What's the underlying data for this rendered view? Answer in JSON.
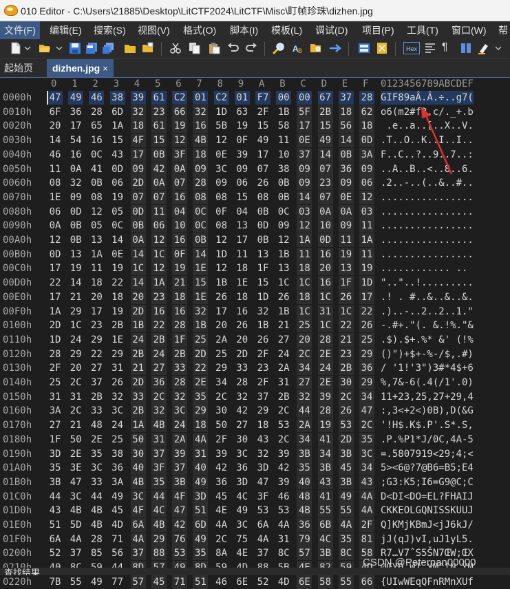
{
  "title": "010 Editor - C:\\Users\\21885\\Desktop\\LitCTF2024\\LitCTF\\Misc\\盯帧珍珠\\dizhen.jpg",
  "menu": [
    "文件(F)",
    "编辑(E)",
    "搜索(S)",
    "视图(V)",
    "格式(O)",
    "脚本(I)",
    "模板(L)",
    "调试(D)",
    "项目(P)",
    "工具(T)",
    "窗口(W)",
    "帮"
  ],
  "toolbar": {
    "icons": [
      "new-file-icon",
      "open-folder-icon",
      "save-icon",
      "save-as-icon",
      "save-all-icon",
      "folder-icon",
      "folder-open-icon",
      "cut-icon",
      "copy-icon",
      "paste-icon",
      "undo-icon",
      "redo-icon",
      "find-icon",
      "find-replace-icon",
      "find-in-files-icon",
      "goto-icon",
      "compare-icon",
      "calculator-icon",
      "hex-view-icon",
      "format-icon",
      "paragraph-icon",
      "columns-icon",
      "highlight-icon"
    ],
    "hex_label": "Hex",
    "colors": {
      "blue": "#3c78d8",
      "yellow": "#e8b830",
      "orange": "#e08a20"
    }
  },
  "tabs": {
    "home": "起始页",
    "file": "dizhen.jpg",
    "close": "×"
  },
  "hex_header": {
    "columns": [
      "0",
      "1",
      "2",
      "3",
      "4",
      "5",
      "6",
      "7",
      "8",
      "9",
      "A",
      "B",
      "C",
      "D",
      "E",
      "F"
    ],
    "ascii": "0123456789ABCDEF"
  },
  "rows": [
    {
      "addr": "0000h",
      "hex": [
        "47",
        "49",
        "46",
        "38",
        "39",
        "61",
        "C2",
        "01",
        "C2",
        "01",
        "F7",
        "00",
        "00",
        "67",
        "37",
        "28"
      ],
      "ascii": "GIF89aÂ.Â.÷..g7("
    },
    {
      "addr": "0010h",
      "hex": [
        "6F",
        "36",
        "28",
        "6D",
        "32",
        "23",
        "66",
        "32",
        "1D",
        "63",
        "2F",
        "1B",
        "5F",
        "2B",
        "18",
        "62"
      ],
      "ascii": "o6(m2#f2.c/._+.b"
    },
    {
      "addr": "0020h",
      "hex": [
        "20",
        "17",
        "65",
        "1A",
        "18",
        "61",
        "19",
        "16",
        "5B",
        "19",
        "15",
        "58",
        "17",
        "15",
        "56",
        "18"
      ],
      "ascii": " .e..a..[..X..V."
    },
    {
      "addr": "0030h",
      "hex": [
        "14",
        "54",
        "16",
        "15",
        "4F",
        "15",
        "12",
        "4B",
        "12",
        "0F",
        "49",
        "11",
        "0E",
        "49",
        "14",
        "0D"
      ],
      "ascii": ".T..O..K..I..I.."
    },
    {
      "addr": "0040h",
      "hex": [
        "46",
        "16",
        "0C",
        "43",
        "17",
        "0B",
        "3F",
        "18",
        "0E",
        "39",
        "17",
        "10",
        "37",
        "14",
        "0B",
        "3A"
      ],
      "ascii": "F..C..?..9..7..:"
    },
    {
      "addr": "0050h",
      "hex": [
        "11",
        "0A",
        "41",
        "0D",
        "09",
        "42",
        "0A",
        "09",
        "3C",
        "09",
        "07",
        "38",
        "09",
        "07",
        "36",
        "09"
      ],
      "ascii": "..A..B..<..8..6."
    },
    {
      "addr": "0060h",
      "hex": [
        "08",
        "32",
        "0B",
        "06",
        "2D",
        "0A",
        "07",
        "28",
        "09",
        "06",
        "26",
        "0B",
        "09",
        "23",
        "09",
        "06"
      ],
      "ascii": ".2..-..(..&..#.."
    },
    {
      "addr": "0070h",
      "hex": [
        "1E",
        "09",
        "08",
        "19",
        "07",
        "07",
        "16",
        "08",
        "08",
        "15",
        "08",
        "0B",
        "14",
        "07",
        "0E",
        "12"
      ],
      "ascii": "................"
    },
    {
      "addr": "0080h",
      "hex": [
        "06",
        "0D",
        "12",
        "05",
        "0D",
        "11",
        "04",
        "0C",
        "0F",
        "04",
        "0B",
        "0C",
        "03",
        "0A",
        "0A",
        "03"
      ],
      "ascii": "................"
    },
    {
      "addr": "0090h",
      "hex": [
        "0A",
        "0B",
        "05",
        "0C",
        "0B",
        "06",
        "10",
        "0C",
        "08",
        "13",
        "0D",
        "09",
        "12",
        "10",
        "09",
        "11"
      ],
      "ascii": "................"
    },
    {
      "addr": "00A0h",
      "hex": [
        "12",
        "0B",
        "13",
        "14",
        "0A",
        "12",
        "16",
        "0B",
        "12",
        "17",
        "0B",
        "12",
        "1A",
        "0D",
        "11",
        "1A"
      ],
      "ascii": "................"
    },
    {
      "addr": "00B0h",
      "hex": [
        "0D",
        "13",
        "1A",
        "0E",
        "14",
        "1C",
        "0F",
        "14",
        "1D",
        "11",
        "13",
        "1B",
        "11",
        "16",
        "19",
        "11"
      ],
      "ascii": "................"
    },
    {
      "addr": "00C0h",
      "hex": [
        "17",
        "19",
        "11",
        "19",
        "1C",
        "12",
        "19",
        "1E",
        "12",
        "18",
        "1F",
        "13",
        "18",
        "20",
        "13",
        "19"
      ],
      "ascii": "............ .. "
    },
    {
      "addr": "00D0h",
      "hex": [
        "22",
        "14",
        "18",
        "22",
        "14",
        "1A",
        "21",
        "15",
        "1B",
        "1E",
        "15",
        "1C",
        "1C",
        "16",
        "1F",
        "1D"
      ],
      "ascii": "\"..\"..!........."
    },
    {
      "addr": "00E0h",
      "hex": [
        "17",
        "21",
        "20",
        "18",
        "20",
        "23",
        "18",
        "1E",
        "26",
        "18",
        "1D",
        "26",
        "18",
        "1C",
        "26",
        "17"
      ],
      "ascii": ".! . #..&..&..&."
    },
    {
      "addr": "00F0h",
      "hex": [
        "1A",
        "29",
        "17",
        "19",
        "2D",
        "16",
        "16",
        "32",
        "17",
        "16",
        "32",
        "1B",
        "1C",
        "31",
        "1C",
        "22"
      ],
      "ascii": ".)..-..2..2..1.\""
    },
    {
      "addr": "0100h",
      "hex": [
        "2D",
        "1C",
        "23",
        "2B",
        "1B",
        "22",
        "28",
        "1B",
        "20",
        "26",
        "1B",
        "21",
        "25",
        "1C",
        "22",
        "26"
      ],
      "ascii": "-.#+.\"(. &.!%.\"&"
    },
    {
      "addr": "0110h",
      "hex": [
        "1D",
        "24",
        "29",
        "1E",
        "24",
        "2B",
        "1F",
        "25",
        "2A",
        "20",
        "26",
        "27",
        "20",
        "28",
        "21",
        "25"
      ],
      "ascii": ".$).$+.%* &' (!%"
    },
    {
      "addr": "0120h",
      "hex": [
        "28",
        "29",
        "22",
        "29",
        "2B",
        "24",
        "2B",
        "2D",
        "25",
        "2D",
        "2F",
        "24",
        "2C",
        "2E",
        "23",
        "29"
      ],
      "ascii": "()\")+$+-%-/$,.#)"
    },
    {
      "addr": "0130h",
      "hex": [
        "2F",
        "20",
        "27",
        "31",
        "21",
        "27",
        "33",
        "22",
        "29",
        "33",
        "23",
        "2A",
        "34",
        "24",
        "2B",
        "36"
      ],
      "ascii": "/ '1!'3\")3#*4$+6"
    },
    {
      "addr": "0140h",
      "hex": [
        "25",
        "2C",
        "37",
        "26",
        "2D",
        "36",
        "28",
        "2E",
        "34",
        "28",
        "2F",
        "31",
        "27",
        "2E",
        "30",
        "29"
      ],
      "ascii": "%,7&-6(.4(/1'.0)"
    },
    {
      "addr": "0150h",
      "hex": [
        "31",
        "31",
        "2B",
        "32",
        "33",
        "2C",
        "32",
        "35",
        "2C",
        "32",
        "37",
        "2B",
        "32",
        "39",
        "2C",
        "34"
      ],
      "ascii": "11+23,25,27+29,4"
    },
    {
      "addr": "0160h",
      "hex": [
        "3A",
        "2C",
        "33",
        "3C",
        "2B",
        "32",
        "3C",
        "29",
        "30",
        "42",
        "29",
        "2C",
        "44",
        "28",
        "26",
        "47"
      ],
      "ascii": ":,3<+2<)0B),D(&G"
    },
    {
      "addr": "0170h",
      "hex": [
        "27",
        "21",
        "48",
        "24",
        "1A",
        "4B",
        "24",
        "18",
        "50",
        "27",
        "18",
        "53",
        "2A",
        "19",
        "53",
        "2C"
      ],
      "ascii": "'!H$.K$.P'.S*.S,"
    },
    {
      "addr": "0180h",
      "hex": [
        "1F",
        "50",
        "2E",
        "25",
        "50",
        "31",
        "2A",
        "4A",
        "2F",
        "30",
        "43",
        "2C",
        "34",
        "41",
        "2D",
        "35"
      ],
      "ascii": ".P.%P1*J/0C,4A-5"
    },
    {
      "addr": "0190h",
      "hex": [
        "3D",
        "2E",
        "35",
        "38",
        "30",
        "37",
        "39",
        "31",
        "39",
        "3C",
        "32",
        "39",
        "3B",
        "34",
        "3B",
        "3C"
      ],
      "ascii": "=.5807919<29;4;<"
    },
    {
      "addr": "01A0h",
      "hex": [
        "35",
        "3E",
        "3C",
        "36",
        "40",
        "3F",
        "37",
        "40",
        "42",
        "36",
        "3D",
        "42",
        "35",
        "3B",
        "45",
        "34"
      ],
      "ascii": "5><6@?7@B6=B5;E4"
    },
    {
      "addr": "01B0h",
      "hex": [
        "3B",
        "47",
        "33",
        "3A",
        "4B",
        "35",
        "3B",
        "49",
        "36",
        "3D",
        "47",
        "39",
        "40",
        "43",
        "3B",
        "43"
      ],
      "ascii": ";G3:K5;I6=G9@C;C"
    },
    {
      "addr": "01C0h",
      "hex": [
        "44",
        "3C",
        "44",
        "49",
        "3C",
        "44",
        "4F",
        "3D",
        "45",
        "4C",
        "3F",
        "46",
        "48",
        "41",
        "49",
        "4A"
      ],
      "ascii": "D<DI<DO=EL?FHAIJ"
    },
    {
      "addr": "01D0h",
      "hex": [
        "43",
        "4B",
        "4B",
        "45",
        "4F",
        "4C",
        "47",
        "51",
        "4E",
        "49",
        "53",
        "53",
        "4B",
        "55",
        "55",
        "4A"
      ],
      "ascii": "CKKEOLGQNISSKUUJ"
    },
    {
      "addr": "01E0h",
      "hex": [
        "51",
        "5D",
        "4B",
        "4D",
        "6A",
        "4B",
        "42",
        "6D",
        "4A",
        "3C",
        "6A",
        "4A",
        "36",
        "6B",
        "4A",
        "2F"
      ],
      "ascii": "Q]KMjKBmJ<jJ6kJ/"
    },
    {
      "addr": "01F0h",
      "hex": [
        "6A",
        "4A",
        "28",
        "71",
        "4A",
        "29",
        "76",
        "49",
        "2C",
        "75",
        "4A",
        "31",
        "79",
        "4C",
        "35",
        "81"
      ],
      "ascii": "jJ(qJ)vI,uJ1yL5."
    },
    {
      "addr": "0200h",
      "hex": [
        "52",
        "37",
        "85",
        "56",
        "37",
        "88",
        "53",
        "35",
        "8A",
        "4E",
        "37",
        "8C",
        "57",
        "3B",
        "8C",
        "58"
      ],
      "ascii": "R7…V7ˆS5ŠN7ŒW;ŒX"
    },
    {
      "addr": "0210h",
      "hex": [
        "40",
        "8C",
        "59",
        "44",
        "8D",
        "57",
        "49",
        "8D",
        "59",
        "4D",
        "88",
        "5B",
        "4E",
        "82",
        "59",
        "4D"
      ],
      "ascii": "@ŒYD.WI.YM^[N‚YM"
    },
    {
      "addr": "0220h",
      "hex": [
        "7B",
        "55",
        "49",
        "77",
        "57",
        "45",
        "71",
        "51",
        "46",
        "6E",
        "52",
        "4D",
        "6E",
        "58",
        "55",
        "66"
      ],
      "ascii": "{UIwWEqQFnRMnXUf"
    }
  ],
  "status": "查找结果",
  "watermark": "CSDN @Peterpan00000"
}
